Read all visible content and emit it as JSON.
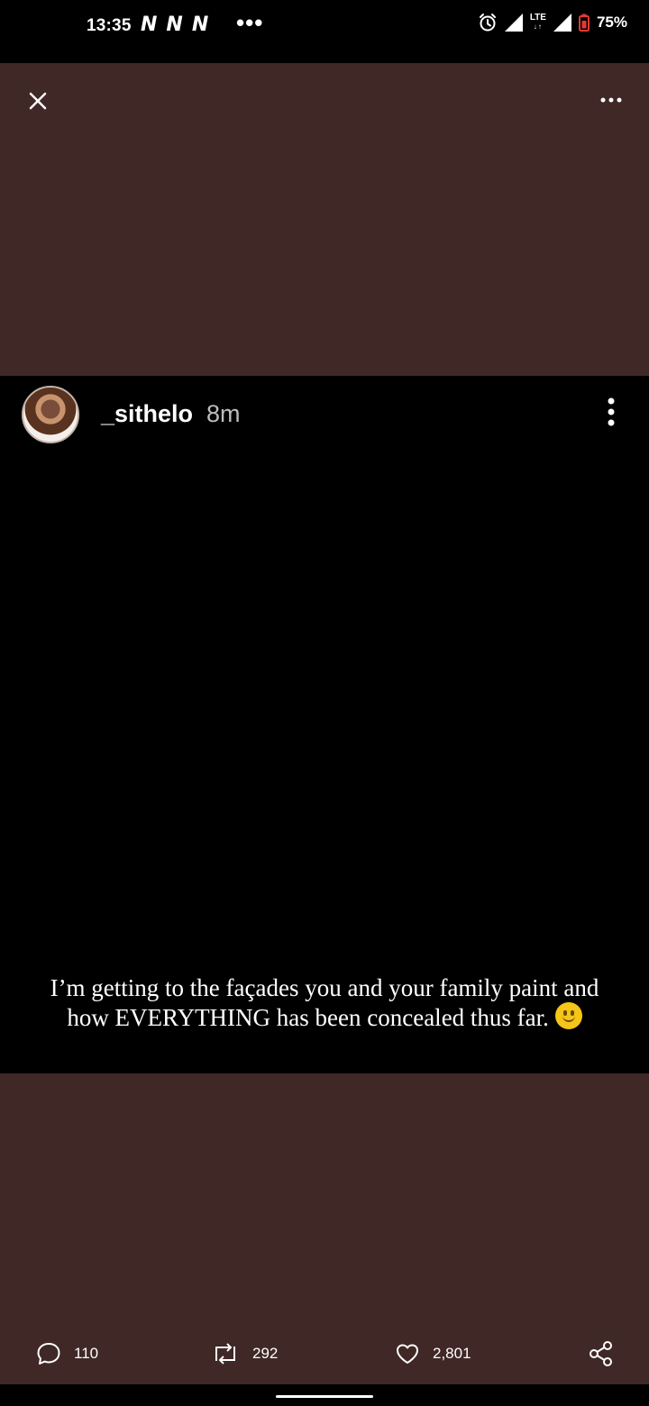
{
  "status_bar": {
    "time": "13:35",
    "notification_icons": [
      "N",
      "N",
      "N"
    ],
    "more_dots": "•••",
    "network": "LTE",
    "battery": "75%"
  },
  "story": {
    "username": "_sithelo",
    "timestamp": "8m",
    "caption_line1": "I’m getting to the façades you and your family paint and",
    "caption_line2": "how EVERYTHING has been concealed thus far."
  },
  "actions": {
    "comments": "110",
    "reposts": "292",
    "likes": "2,801"
  },
  "colors": {
    "background_brown": "#3f2826",
    "story_background": "#000000"
  },
  "icons": [
    "close-icon",
    "more-horizontal-icon",
    "more-vertical-icon",
    "comment-icon",
    "repost-icon",
    "heart-icon",
    "share-icon",
    "alarm-icon",
    "signal-icon",
    "battery-icon"
  ]
}
